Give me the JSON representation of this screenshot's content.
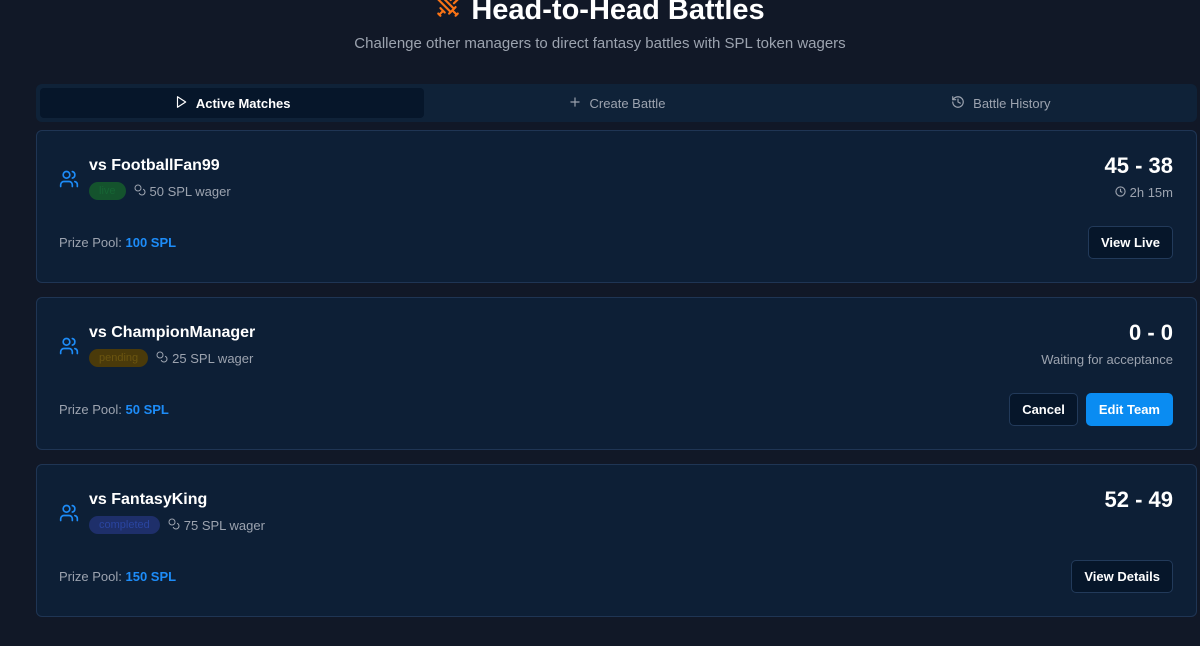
{
  "header": {
    "title": "Head-to-Head Battles",
    "subtitle": "Challenge other managers to direct fantasy battles with SPL token wagers",
    "title_icon": "crossed-swords-icon",
    "title_icon_color": "#f97316"
  },
  "tabs": [
    {
      "label": "Active Matches",
      "icon": "play-icon",
      "active": true
    },
    {
      "label": "Create Battle",
      "icon": "plus-icon",
      "active": false
    },
    {
      "label": "Battle History",
      "icon": "history-icon",
      "active": false
    }
  ],
  "matches": [
    {
      "opponent": "vs FootballFan99",
      "status": "live",
      "wager": "50 SPL wager",
      "prize_label": "Prize Pool:",
      "prize_amount": "100 SPL",
      "score": "45 - 38",
      "subinfo": "2h 15m",
      "actions": [
        "View Live"
      ]
    },
    {
      "opponent": "vs ChampionManager",
      "status": "pending",
      "wager": "25 SPL wager",
      "prize_label": "Prize Pool:",
      "prize_amount": "50 SPL",
      "score": "0 - 0",
      "subinfo": "Waiting for acceptance",
      "actions": [
        "Cancel",
        "Edit Team"
      ]
    },
    {
      "opponent": "vs FantasyKing",
      "status": "completed",
      "wager": "75 SPL wager",
      "prize_label": "Prize Pool:",
      "prize_amount": "150 SPL",
      "score": "52 - 49",
      "subinfo": "",
      "actions": [
        "View Details"
      ]
    }
  ],
  "colors": {
    "background": "#111827",
    "card": "#0d1f36",
    "accent": "#0a8cf2",
    "prize": "#1d8cf8"
  }
}
